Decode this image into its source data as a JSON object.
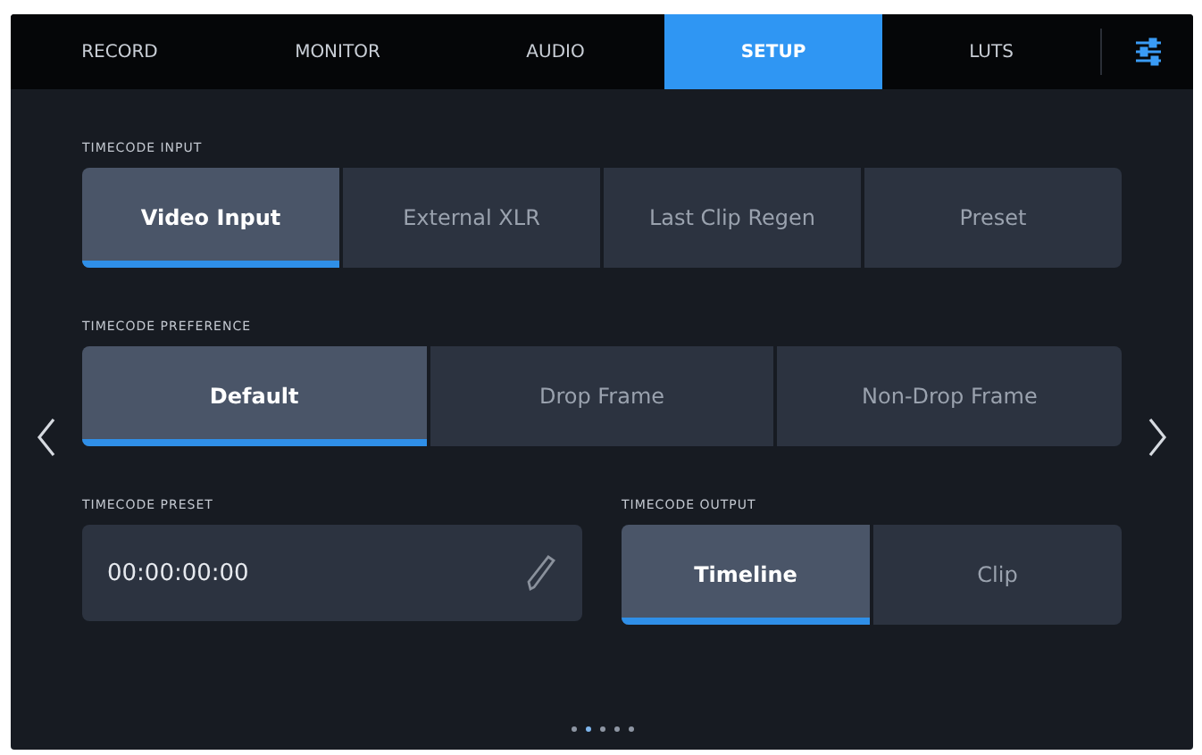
{
  "tabs": [
    {
      "label": "RECORD",
      "selected": false
    },
    {
      "label": "MONITOR",
      "selected": false
    },
    {
      "label": "AUDIO",
      "selected": false
    },
    {
      "label": "SETUP",
      "selected": true
    },
    {
      "label": "LUTS",
      "selected": false
    }
  ],
  "timecode_input": {
    "label": "TIMECODE INPUT",
    "options": [
      {
        "label": "Video Input",
        "selected": true
      },
      {
        "label": "External XLR",
        "selected": false
      },
      {
        "label": "Last Clip Regen",
        "selected": false
      },
      {
        "label": "Preset",
        "selected": false
      }
    ]
  },
  "timecode_preference": {
    "label": "TIMECODE PREFERENCE",
    "options": [
      {
        "label": "Default",
        "selected": true
      },
      {
        "label": "Drop Frame",
        "selected": false
      },
      {
        "label": "Non-Drop Frame",
        "selected": false
      }
    ]
  },
  "timecode_preset": {
    "label": "TIMECODE PRESET",
    "value": "00:00:00:00"
  },
  "timecode_output": {
    "label": "TIMECODE OUTPUT",
    "options": [
      {
        "label": "Timeline",
        "selected": true
      },
      {
        "label": "Clip",
        "selected": false
      }
    ]
  },
  "pages": [
    {
      "selected": false
    },
    {
      "selected": true
    },
    {
      "selected": false
    },
    {
      "selected": false
    },
    {
      "selected": false
    }
  ]
}
